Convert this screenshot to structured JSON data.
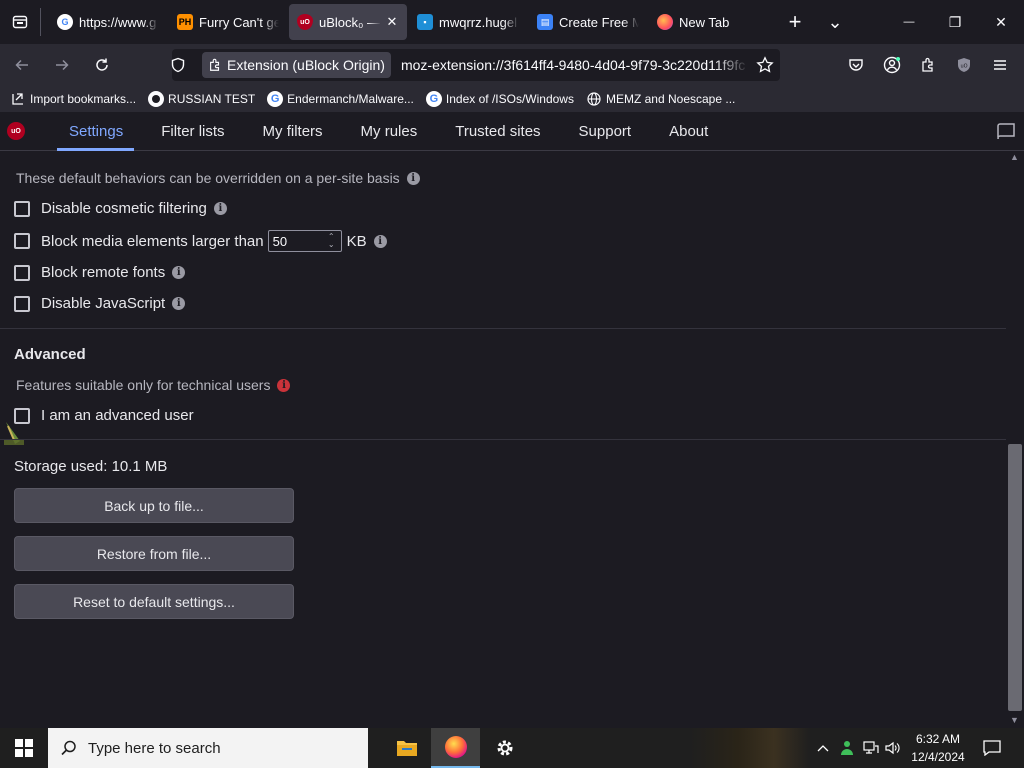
{
  "tabs": [
    {
      "label": "https://www.g",
      "icon": "google-icon",
      "active": false
    },
    {
      "label": "Furry Can't ge",
      "icon": "ph-icon",
      "active": false
    },
    {
      "label": "uBlock₀ — ",
      "icon": "ublock-icon",
      "active": true
    },
    {
      "label": "mwqrrz.hugel",
      "icon": "hugel-icon",
      "active": false
    },
    {
      "label": "Create Free M",
      "icon": "docs-icon",
      "active": false
    },
    {
      "label": "New Tab",
      "icon": "firefox-icon",
      "active": false
    }
  ],
  "tab_close_glyph": "✕",
  "new_tab_glyph": "+",
  "tab_list_glyph": "⌄",
  "window": {
    "minimize": "—",
    "restore": "❐",
    "close": "✕"
  },
  "navbar": {
    "identity_label": "Extension (uBlock Origin)",
    "url": "moz-extension://3f614ff4-9480-4d04-9f79-3c220d11f9fc"
  },
  "bookmarks": [
    {
      "label": "Import bookmarks...",
      "icon": "import-icon"
    },
    {
      "label": "RUSSIAN TEST",
      "icon": "github-icon"
    },
    {
      "label": "Endermanch/Malware...",
      "icon": "google-icon"
    },
    {
      "label": "Index of /ISOs/Windows",
      "icon": "google-icon"
    },
    {
      "label": "MEMZ and Noescape ...",
      "icon": "globe-icon"
    }
  ],
  "ublock_nav": {
    "logo_text": "uO",
    "tabs": [
      "Settings",
      "Filter lists",
      "My filters",
      "My rules",
      "Trusted sites",
      "Support",
      "About"
    ],
    "active": "Settings"
  },
  "default_behavior": {
    "note": "These default behaviors can be overridden on a per-site basis",
    "options": [
      {
        "label": "Disable cosmetic filtering",
        "checked": false
      },
      {
        "label": "Block media elements larger than",
        "checked": false,
        "value": "50",
        "unit": "KB"
      },
      {
        "label": "Block remote fonts",
        "checked": false
      },
      {
        "label": "Disable JavaScript",
        "checked": false
      }
    ]
  },
  "advanced": {
    "heading": "Advanced",
    "note": "Features suitable only for technical users",
    "option": {
      "label": "I am an advanced user",
      "checked": false
    }
  },
  "storage_label": "Storage used: 10.1 MB",
  "buttons": {
    "backup": "Back up to file...",
    "restore": "Restore from file...",
    "reset": "Reset to default settings..."
  },
  "info_glyph": "i",
  "taskbar": {
    "search_placeholder": "Type here to search",
    "time": "6:32 AM",
    "date": "12/4/2024"
  },
  "colors": {
    "accent": "#80a8ff",
    "ublock_red": "#b00020",
    "background": "#1c1b22"
  }
}
